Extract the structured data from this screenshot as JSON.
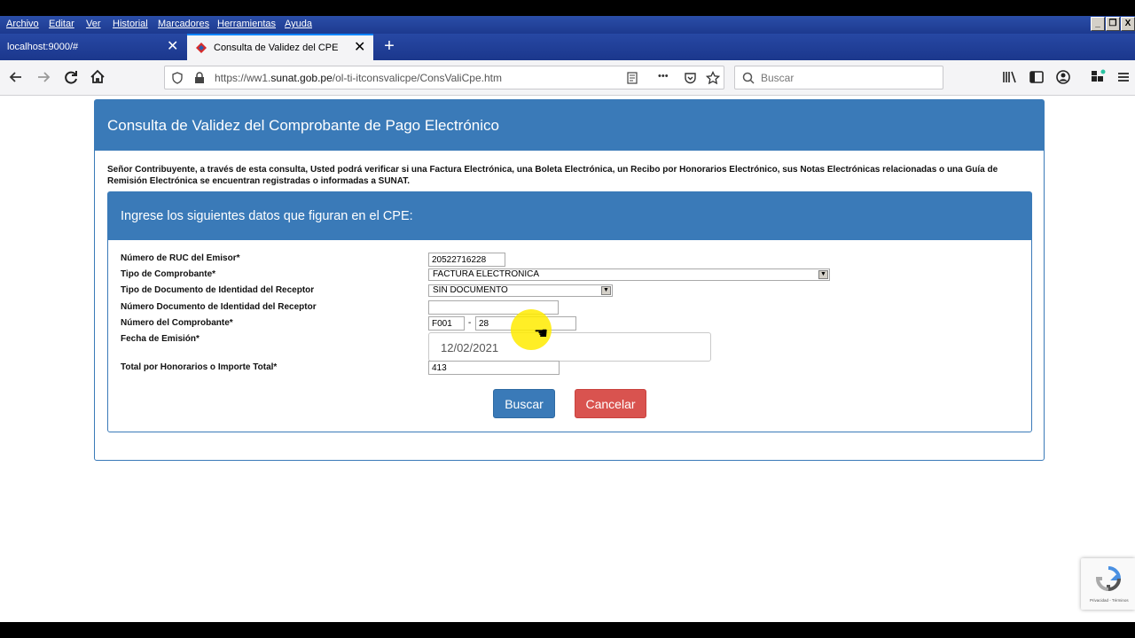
{
  "menubar": {
    "items": [
      "Archivo",
      "Editar",
      "Ver",
      "Historial",
      "Marcadores",
      "Herramientas",
      "Ayuda"
    ],
    "window_buttons": [
      "_",
      "❐",
      "X"
    ]
  },
  "tabs": [
    {
      "label": "localhost:9000/#",
      "close": "✕"
    },
    {
      "label": "Consulta de Validez del CPE",
      "close": "✕"
    }
  ],
  "new_tab": "+",
  "toolbar": {
    "url_prefix": "https://ww1.",
    "url_domain": "sunat.gob.pe",
    "url_path": "/ol-ti-itconsvalicpe/ConsValiCpe.htm",
    "search_placeholder": "Buscar",
    "more": "•••"
  },
  "page": {
    "title": "Consulta de Validez del Comprobante de Pago Electrónico",
    "intro": "Señor Contribuyente, a través de esta consulta, Usted podrá verificar si una Factura Electrónica, una Boleta Electrónica, un Recibo por Honorarios Electrónico, sus Notas Electrónicas relacionadas o una Guía de Remisión Electrónica se encuentran registradas o informadas a SUNAT.",
    "form_title": "Ingrese los siguientes datos que figuran en el CPE:",
    "labels": {
      "ruc": "Número de RUC del Emisor*",
      "tipo_comprobante": "Tipo de Comprobante*",
      "tipo_doc": "Tipo de Documento de Identidad del Receptor",
      "num_doc": "Número Documento de Identidad del Receptor",
      "num_comprobante": "Número del Comprobante*",
      "fecha": "Fecha de Emisión*",
      "total": "Total por Honorarios o Importe Total*"
    },
    "values": {
      "ruc": "20522716228",
      "tipo_comprobante": "FACTURA ELECTRONICA",
      "tipo_doc": "SIN DOCUMENTO",
      "num_doc": "",
      "serie": "F001",
      "separator": "-",
      "numero": "28",
      "fecha": "12/02/2021",
      "total": "413"
    },
    "buttons": {
      "buscar": "Buscar",
      "cancelar": "Cancelar"
    }
  },
  "recaptcha": {
    "footer": "Privacidad - Términos"
  },
  "colors": {
    "primary": "#3a7ab8",
    "danger": "#d9534f",
    "tabbar": "#1e3c92"
  }
}
